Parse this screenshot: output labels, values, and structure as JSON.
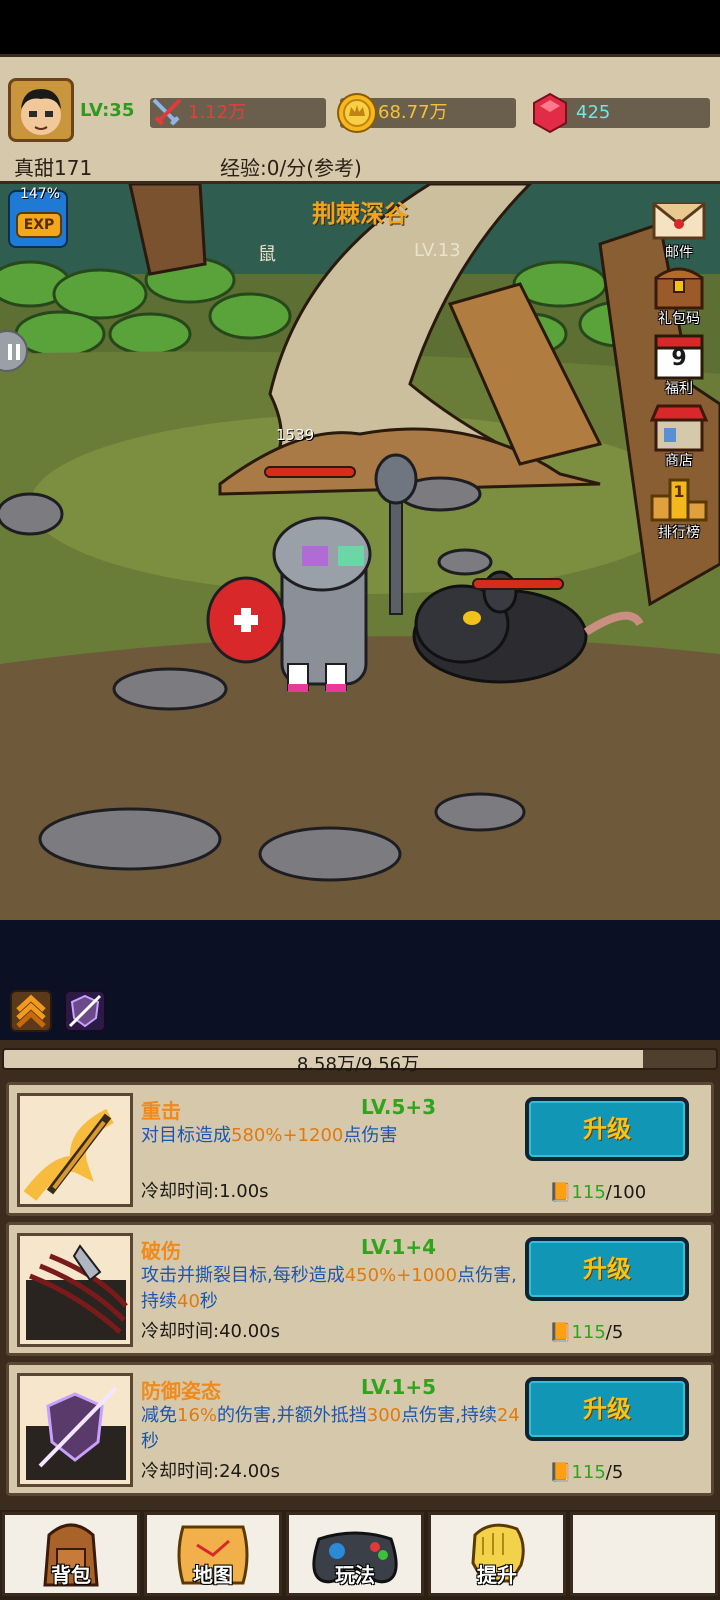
{
  "player": {
    "level": "LV:35",
    "name": "真甜171",
    "exp_rate": "经验:0/分(参考)"
  },
  "resources": {
    "power": "1.12万",
    "gold": "68.77万",
    "gems": "425"
  },
  "exp_boost": {
    "percent": "147%",
    "label": "EXP"
  },
  "battle": {
    "stage_title": "荆棘深谷",
    "enemy_name": "鼠",
    "enemy_level": "LV.13",
    "damage_number": "1539",
    "player_hp_fraction": 1.0,
    "enemy_hp_fraction": 1.0
  },
  "side_menu": [
    {
      "label": "邮件",
      "icon": "mail-envelope-icon"
    },
    {
      "label": "礼包码",
      "icon": "treasure-chest-icon"
    },
    {
      "label": "福利",
      "icon": "calendar-icon",
      "badge": "9"
    },
    {
      "label": "商店",
      "icon": "shop-icon"
    },
    {
      "label": "排行榜",
      "icon": "leaderboard-podium-icon",
      "badge": "1"
    }
  ],
  "xp_bar": {
    "text": "8.58万/9.56万",
    "current": 8.58,
    "max": 9.56
  },
  "skills": [
    {
      "name": "重击",
      "level": "LV.5+3",
      "desc_before": "对目标造成",
      "desc_highlight": "580%+1200",
      "desc_after": "点伤害",
      "cooldown": "冷却时间:1.00s",
      "button": "升级",
      "books_have": "115",
      "books_need": "/100",
      "icon": "flaming-blade-icon"
    },
    {
      "name": "破伤",
      "level": "LV.1+4",
      "desc_before": "攻击并撕裂目标,每秒造成",
      "desc_highlight": "450%+1000",
      "desc_after": "点伤害,持续",
      "desc_highlight2": "40",
      "desc_after2": "秒",
      "cooldown": "冷却时间:40.00s",
      "button": "升级",
      "books_have": "115",
      "books_need": "/5",
      "icon": "claw-slash-icon"
    },
    {
      "name": "防御姿态",
      "level": "LV.1+5",
      "desc_before": "减免",
      "desc_highlight": "16%",
      "desc_after": "的伤害,并额外抵挡",
      "desc_highlight2": "300",
      "desc_after2": "点伤害,持续",
      "desc_highlight3": "24",
      "desc_after3": "秒",
      "cooldown": "冷却时间:24.00s",
      "button": "升级",
      "books_have": "115",
      "books_need": "/5",
      "icon": "shield-strike-icon"
    }
  ],
  "bottom_nav": [
    {
      "label": "背包",
      "icon": "backpack-icon"
    },
    {
      "label": "地图",
      "icon": "map-scroll-icon"
    },
    {
      "label": "玩法",
      "icon": "gamepad-icon"
    },
    {
      "label": "提升",
      "icon": "fist-icon"
    },
    {
      "label": "",
      "icon": ""
    }
  ],
  "colors": {
    "accent_orange": "#ef8a1b",
    "level_green": "#2fa51d",
    "desc_blue": "#1d56b0",
    "button_teal": "#1296b5",
    "panel_tan": "#d6c9ab"
  }
}
